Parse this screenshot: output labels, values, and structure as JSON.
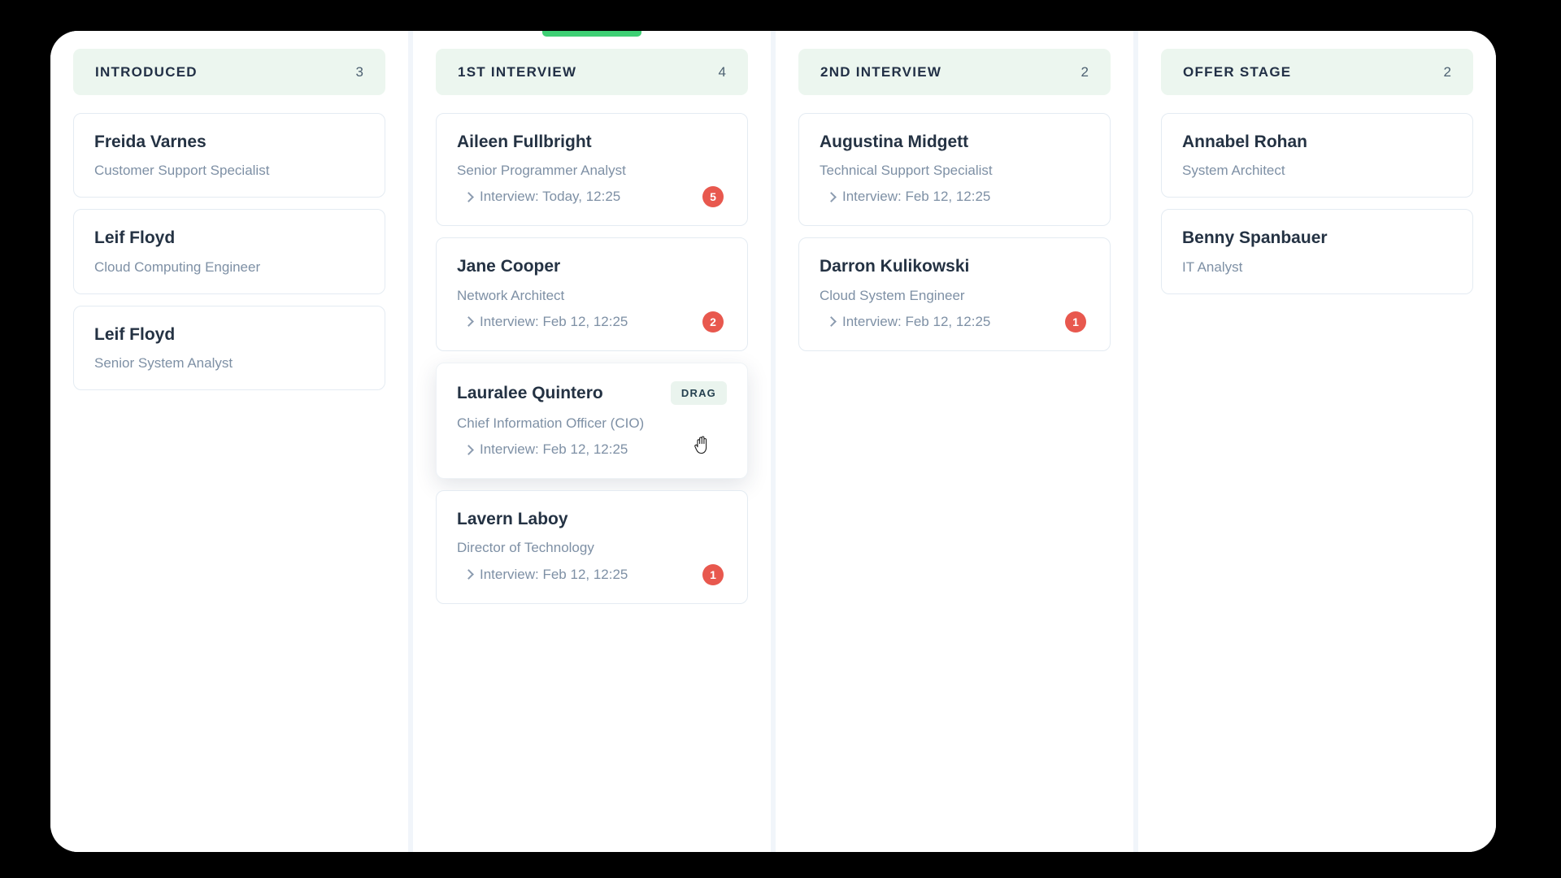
{
  "board": {
    "background_color": "#000000",
    "surface_color": "#ffffff",
    "header_color": "#ecf6ef",
    "accent_color": "#3ecf74",
    "badge_color": "#e8584e",
    "drag_chip_label": "DRAG",
    "meta_prefix_icon": "chevron-right-icon",
    "cursor_icon": "grab-hand-cursor"
  },
  "columns": [
    {
      "id": "introduced",
      "title": "INTRODUCED",
      "count": "3",
      "drop_indicator": false,
      "cards": [
        {
          "name": "Freida Varnes",
          "role": "Customer Support Specialist",
          "interview": "",
          "badge": "",
          "dragging": false
        },
        {
          "name": "Leif Floyd",
          "role": "Cloud Computing Engineer",
          "interview": "",
          "badge": "",
          "dragging": false
        },
        {
          "name": "Leif Floyd",
          "role": "Senior System Analyst",
          "interview": "",
          "badge": "",
          "dragging": false
        }
      ]
    },
    {
      "id": "1st-interview",
      "title": "1ST INTERVIEW",
      "count": "4",
      "drop_indicator": true,
      "cards": [
        {
          "name": "Aileen Fullbright",
          "role": "Senior Programmer Analyst",
          "interview": "Interview: Today, 12:25",
          "badge": "5",
          "dragging": false
        },
        {
          "name": "Jane Cooper",
          "role": "Network Architect",
          "interview": "Interview: Feb 12, 12:25",
          "badge": "2",
          "dragging": false
        },
        {
          "name": "Lauralee Quintero",
          "role": "Chief Information Officer (CIO)",
          "interview": "Interview: Feb 12, 12:25",
          "badge": "",
          "dragging": true
        },
        {
          "name": "Lavern Laboy",
          "role": "Director of Technology",
          "interview": "Interview: Feb 12, 12:25",
          "badge": "1",
          "dragging": false
        }
      ]
    },
    {
      "id": "2nd-interview",
      "title": "2ND INTERVIEW",
      "count": "2",
      "drop_indicator": false,
      "cards": [
        {
          "name": "Augustina Midgett",
          "role": "Technical Support Specialist",
          "interview": "Interview: Feb 12, 12:25",
          "badge": "",
          "dragging": false
        },
        {
          "name": "Darron Kulikowski",
          "role": "Cloud System Engineer",
          "interview": "Interview: Feb 12, 12:25",
          "badge": "1",
          "dragging": false
        }
      ]
    },
    {
      "id": "offer-stage",
      "title": "OFFER STAGE",
      "count": "2",
      "drop_indicator": false,
      "cards": [
        {
          "name": "Annabel Rohan",
          "role": "System Architect",
          "interview": "",
          "badge": "",
          "dragging": false
        },
        {
          "name": "Benny Spanbauer",
          "role": "IT Analyst",
          "interview": "",
          "badge": "",
          "dragging": false
        }
      ]
    }
  ]
}
